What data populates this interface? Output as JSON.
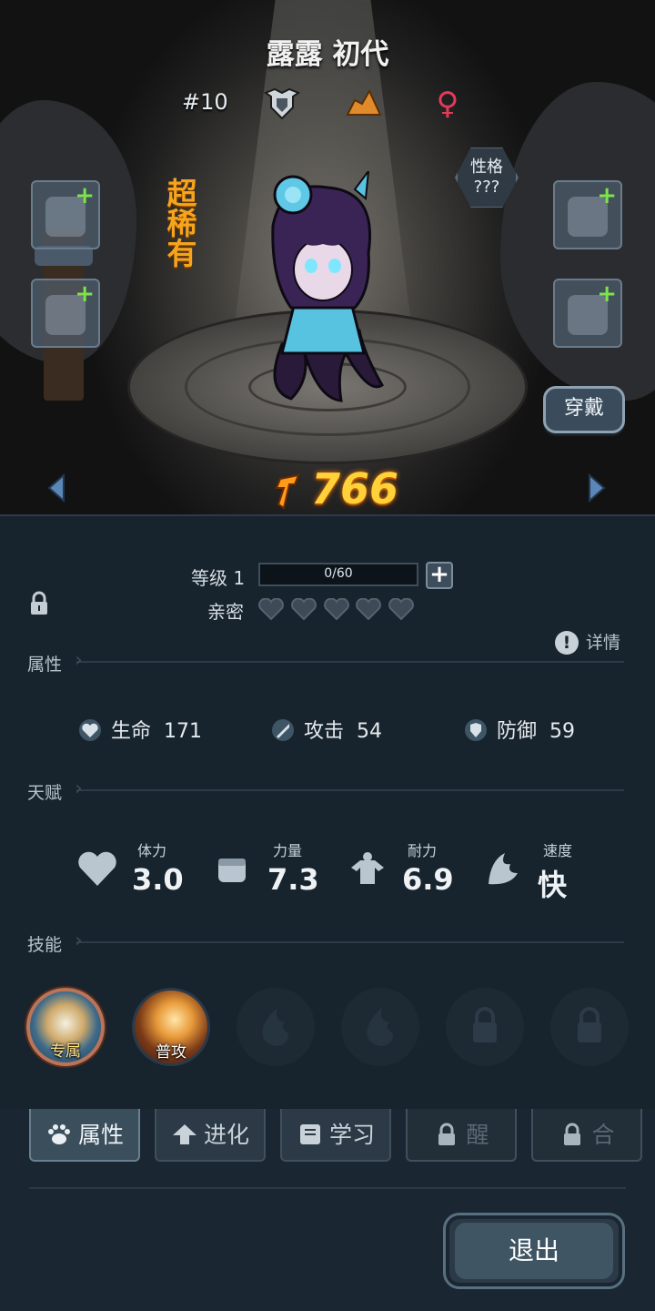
{
  "header": {
    "name": "露露 初代",
    "id_label": "#10",
    "rarity": "超稀有",
    "personality_label": "性格",
    "personality_value": "???",
    "gender_symbol": "♀"
  },
  "actions": {
    "wear_label": "穿戴"
  },
  "power": {
    "value": "766"
  },
  "level": {
    "label": "等级 1",
    "xp_text": "0/60",
    "xp_fraction": 0
  },
  "intimacy": {
    "label": "亲密",
    "hearts_filled": 0,
    "hearts_total": 5
  },
  "details_label": "详情",
  "sections": {
    "attributes": "属性",
    "talents": "天赋",
    "skills": "技能"
  },
  "stats": [
    {
      "label": "生命",
      "value": "171",
      "icon": "heart-shield-icon"
    },
    {
      "label": "攻击",
      "value": "54",
      "icon": "sword-icon"
    },
    {
      "label": "防御",
      "value": "59",
      "icon": "shield-icon"
    }
  ],
  "talents": [
    {
      "label": "体力",
      "value": "3.0",
      "icon": "heart-icon"
    },
    {
      "label": "力量",
      "value": "7.3",
      "icon": "fist-icon"
    },
    {
      "label": "耐力",
      "value": "6.9",
      "icon": "muscle-icon"
    },
    {
      "label": "速度",
      "value": "快",
      "icon": "wing-icon"
    }
  ],
  "skills": [
    {
      "label": "专属",
      "state": "unlocked"
    },
    {
      "label": "普攻",
      "state": "unlocked"
    },
    {
      "label": "",
      "state": "empty"
    },
    {
      "label": "",
      "state": "empty"
    },
    {
      "label": "",
      "state": "locked"
    },
    {
      "label": "",
      "state": "locked"
    }
  ],
  "tabs": [
    {
      "label": "属性",
      "state": "active"
    },
    {
      "label": "进化",
      "state": "normal"
    },
    {
      "label": "学习",
      "state": "normal"
    },
    {
      "label": "醒",
      "state": "locked"
    },
    {
      "label": "合",
      "state": "locked"
    }
  ],
  "exit_label": "退出",
  "colors": {
    "accent_gold": "#ffd23a",
    "rarity_orange": "#f6a41c",
    "plus_green": "#7de34a",
    "female_pink": "#e23a5a"
  }
}
